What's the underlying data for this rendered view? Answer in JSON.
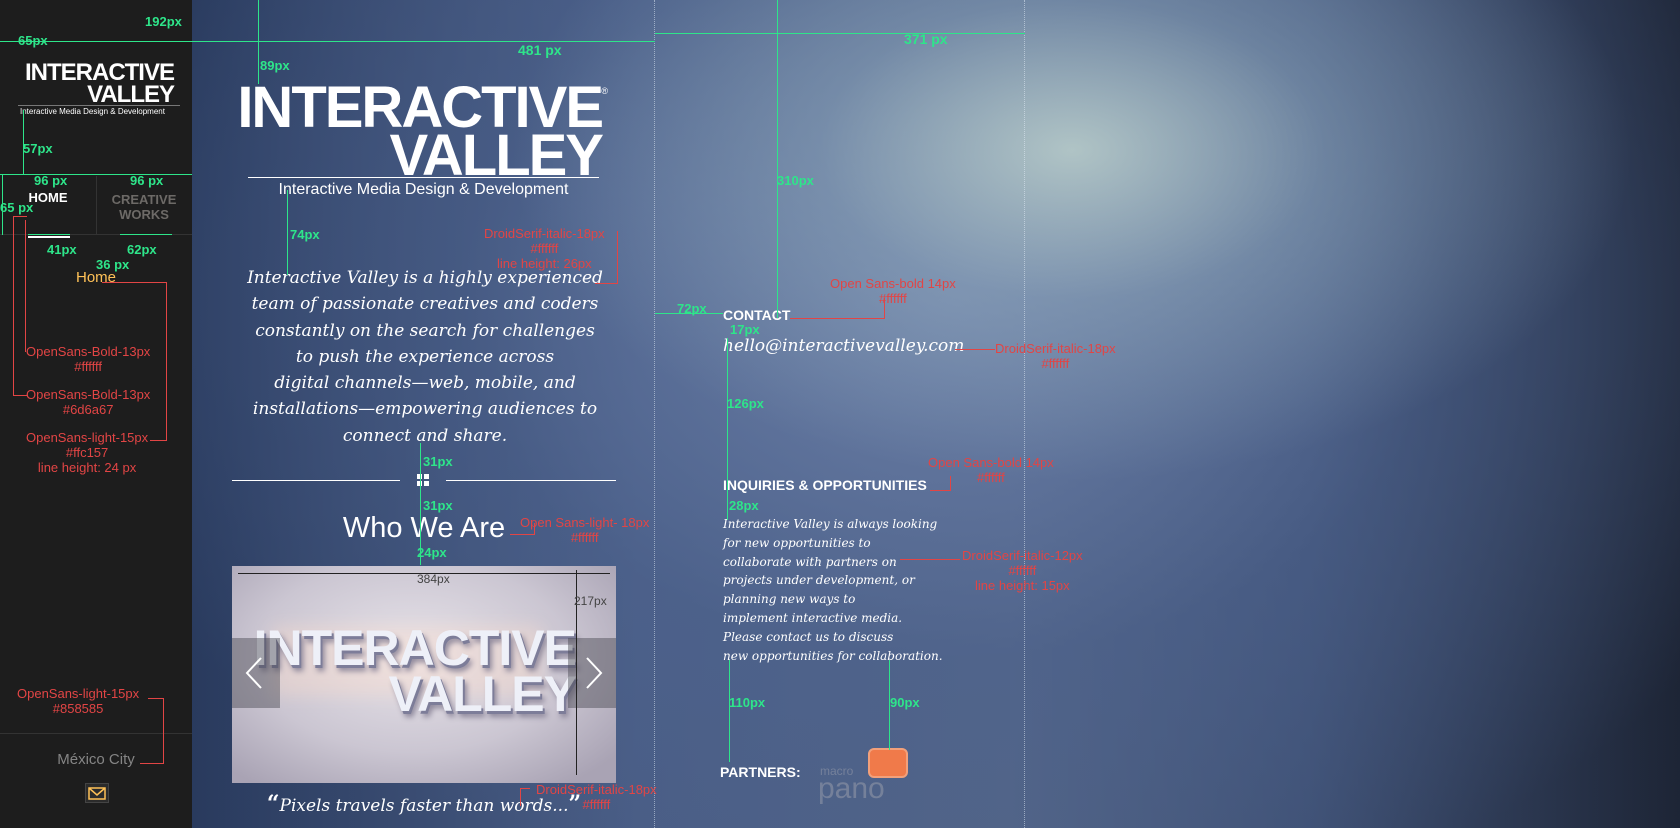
{
  "sidebar": {
    "logo": {
      "line1": "INTERACTIVE",
      "line2": "VALLEY",
      "tagline": "Interactive Media Design & Development"
    },
    "nav": [
      {
        "label": "HOME"
      },
      {
        "label": "CREATIVE WORKS"
      }
    ],
    "current_page": "Home",
    "city": "México City",
    "mail_icon": "envelope-icon"
  },
  "main": {
    "logo": {
      "line1": "INTERACTIVE",
      "line2": "VALLEY",
      "registered": "®",
      "tagline": "Interactive Media Design & Development"
    },
    "intro_lines": [
      "Interactive Valley is a highly experienced",
      "team of passionate creatives and coders",
      "constantly on the search for challenges",
      "to push the experience across",
      "digital channels—web, mobile, and",
      "installations—empowering audiences to",
      "connect and share."
    ],
    "who_we_are": "Who We Are",
    "slider": {
      "line1": "INTERACTIVE",
      "line2": "VALLEY",
      "prev_icon": "chevron-left-icon",
      "next_icon": "chevron-right-icon"
    },
    "quote": {
      "open": "“",
      "text": "Pixels travels faster than words...",
      "close": "”"
    },
    "contact": {
      "heading": "CONTACT",
      "email": "hello@interactivevalley.com"
    },
    "inquiries": {
      "heading": "INQUIRIES & OPPORTUNITIES",
      "lines": [
        "Interactive Valley is always looking",
        "for new opportunities to",
        "collaborate with partners on",
        "projects under development, or",
        "planning new ways to",
        "implement interactive media.",
        "Please contact us to discuss",
        "new opportunities for collaboration."
      ]
    },
    "partners": {
      "heading": "PARTNERS:",
      "logo_small": "macro",
      "logo_big": "pano"
    }
  },
  "annotations": {
    "green": {
      "w192": "192px",
      "h65a": "65px",
      "w481": "481 px",
      "w371": "371 px",
      "h89": "89px",
      "h57": "57px",
      "w96a": "96 px",
      "w96b": "96 px",
      "h65b": "65 px",
      "h74": "74px",
      "h310": "310px",
      "w41": "41px",
      "w62": "62px",
      "w36": "36 px",
      "w72": "72px",
      "h17": "17px",
      "h126": "126px",
      "h31a": "31px",
      "h31b": "31px",
      "h24": "24px",
      "h28": "28px",
      "h110": "110px",
      "h90": "90px"
    },
    "gray": {
      "w384": "384px",
      "h217": "217px"
    },
    "red": {
      "r1": "DroidSerif-italic-18px\n#ffffff\nline height: 26px",
      "r2": "Open Sans-bold 14px\n#ffffff",
      "r3": "DroidSerif-italic-18px\n#ffffff",
      "r4": "OpenSans-Bold-13px\n#ffffff",
      "r5": "OpenSans-Bold-13px\n#6d6a67",
      "r6": "OpenSans-light-15px\n#ffc157\nline height: 24 px",
      "r7": "Open Sans-bold 14px\n#ffffff",
      "r8": "Open Sans-light- 18px\n#ffffff",
      "r9": "DroidSerif-italic-12px\n#ffffff\nline height: 15px",
      "r10": "OpenSans-light-15px\n#858585",
      "r11": "DroidSerif-italic-18px\n#ffffff"
    }
  }
}
